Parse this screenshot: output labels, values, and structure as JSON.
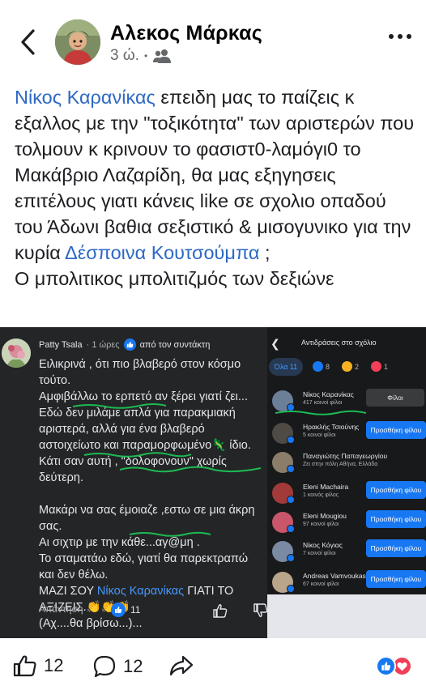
{
  "header": {
    "author_name": "Αλεκος Μάρκας",
    "time": "3 ώ.",
    "separator": "•",
    "audience_icon": "friends-icon",
    "back_icon": "chevron-left-icon",
    "more_icon": "more-horizontal-icon"
  },
  "post": {
    "mention_1": "Νίκος Καρανίκας",
    "text_1": " επειδη μας το παίζεις κ εξαλλος με την \"τοξικότητα\" των αριστερών που τολμουν κ κρινουν το φασιστ0-λαμόγι0 το Μακάβριο Λαζαρίδη, θα μας εξηγησεις επιτέλους γιατι κάνεις like σε σχολιο οπαδού του Άδωνι βαθια σεξιστικό & μισογυνικο για την κυρία ",
    "mention_2": "Δέσποινα Κουτσούμπα",
    "text_2": " ;",
    "text_3": "Ο μπολιτικος μπολιτιζμός των δεξιώνε"
  },
  "embedded": {
    "comment": {
      "author": "Patty Tsala",
      "time": "· 1 ώρες",
      "badge": "από τον συντάκτη",
      "lines": [
        "Ειλικρινά , ότι πιο βλαβερό στον κόσμο",
        "τούτο.",
        "Αμφιβάλλω το ερπετό αν ξέρει γιατί ζει...",
        "Εδώ δεν μιλάμε απλά για παρακμιακή",
        "αριστερά, αλλά για ένα βλαβερό",
        "αστοιχείωτο και παραμορφωμένο🦎 ίδιο.",
        "Κάτι σαν αυτή , \"δολοφονουν\" χωρίς",
        "δεύτερη.",
        "",
        "Μακάρι να σας έμοιαζε ,εστω σε μια άκρη",
        "σας.",
        "Αι σιχτιρ με την κάθε...αγ@μη .",
        "Το σταματάω εδώ,  γιατί θα παρεκτραπώ",
        "και δεν θέλω."
      ],
      "last_prefix": "ΜΑΖΙ ΣΟΥ ",
      "last_mention": "Νίκος Καρανίκας",
      "last_suffix": " ΓΙΑΤΙ ΤΟ",
      "line_axizeis": "ΑΞΙΖΕΙΣ.👏👏👏",
      "line_ach": "(Αχ....θα βρίσω...)...",
      "reply_label": "Απάντηση",
      "like_count": "11"
    },
    "reactions_pane": {
      "title": "Αντιδράσεις στο σχόλιο",
      "tab_all": "Όλα 11",
      "tab_like_count": "8",
      "tab_haha_count": "2",
      "tab_love_count": "1",
      "people": [
        {
          "name": "Νίκος Καρανίκας",
          "sub": "417 κοινοί φίλοι",
          "button": "Φίλοι",
          "button_style": "grey"
        },
        {
          "name": "Ηρακλής Τσιούνης",
          "sub": "5 κοινοί φίλοι",
          "button": "Προσθήκη φίλου",
          "button_style": "blue"
        },
        {
          "name": "Παναγιώτης Παπαγεωργίου",
          "sub": "Ζει στην πόλη Αθήνα, Ελλάδα",
          "button": "",
          "button_style": "none"
        },
        {
          "name": "Eleni Machaira",
          "sub": "1 κοινός φίλος",
          "button": "Προσθήκη φίλου",
          "button_style": "blue"
        },
        {
          "name": "Eleni Mougiou",
          "sub": "97 κοινοί φίλοι",
          "button": "Προσθήκη φίλου",
          "button_style": "blue"
        },
        {
          "name": "Νίκος Κόγιας",
          "sub": "7 κοινοί φίλοι",
          "button": "Προσθήκη φίλου",
          "button_style": "blue"
        },
        {
          "name": "Andreas Vamvoukas",
          "sub": "67 κοινοί φίλοι",
          "button": "Προσθήκη φίλου",
          "button_style": "blue"
        }
      ]
    }
  },
  "actions": {
    "like_count": "12",
    "comment_count": "12",
    "like_icon": "thumbs-up-icon",
    "comment_icon": "comment-bubble-icon",
    "share_icon": "share-arrow-icon"
  },
  "colors": {
    "mention": "#2d68c4",
    "facebook_blue": "#1877f2",
    "love_red": "#f33e58"
  }
}
